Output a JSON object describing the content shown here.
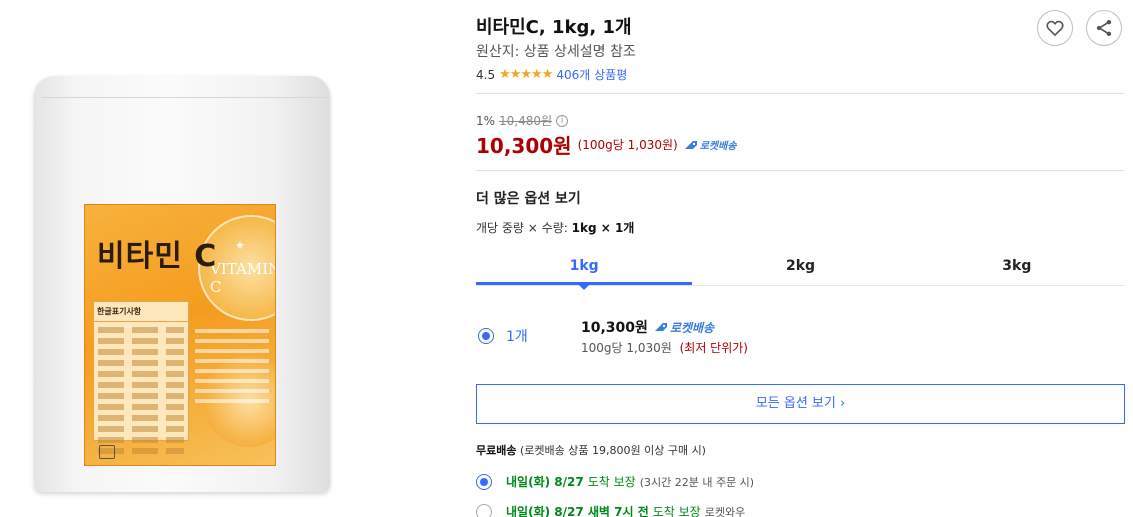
{
  "product": {
    "title": "비타민C, 1kg, 1개",
    "origin": "원산지: 상품 상세설명 참조",
    "rating": "4.5",
    "stars": "★★★★★",
    "review_count": "406개 상품평"
  },
  "image": {
    "label_title": "비타민 C",
    "label_vitamin": "VITAMIN C",
    "info_header": "한글표기사항"
  },
  "price": {
    "discount_rate": "1%",
    "original_price": "10,480원",
    "info_icon": "i",
    "sale_price": "10,300원",
    "unit_price": "(100g당 1,030원)",
    "rocket_label": "로켓배송"
  },
  "options": {
    "heading": "더 많은 옵션 보기",
    "desc_prefix": "개당 중량 × 수량:",
    "desc_value": "1kg × 1개",
    "tabs": [
      "1kg",
      "2kg",
      "3kg"
    ],
    "selected": {
      "qty": "1개",
      "price": "10,300원",
      "rocket_label": "로켓배송",
      "unit_price": "100g당 1,030원",
      "lowest_label": "(최저 단위가)"
    },
    "all_options_button": "모든 옵션 보기 ›"
  },
  "shipping": {
    "free_label": "무료배송",
    "condition": "(로켓배송 상품 19,800원 이상 구매 시)",
    "delivery": [
      {
        "date": "내일(화) 8/27",
        "guarantee": "도착 보장",
        "note": "(3시간 22분 내 주문 시)"
      },
      {
        "date": "내일(화) 8/27 새벽 7시 전",
        "guarantee": "도착 보장",
        "note": "로켓와우"
      }
    ]
  },
  "icons": {
    "wishlist": "heart-icon",
    "share": "share-icon"
  },
  "colors": {
    "accent": "#346aff",
    "price": "#ae0000",
    "delivery": "#00891a",
    "star": "#f5a623"
  }
}
